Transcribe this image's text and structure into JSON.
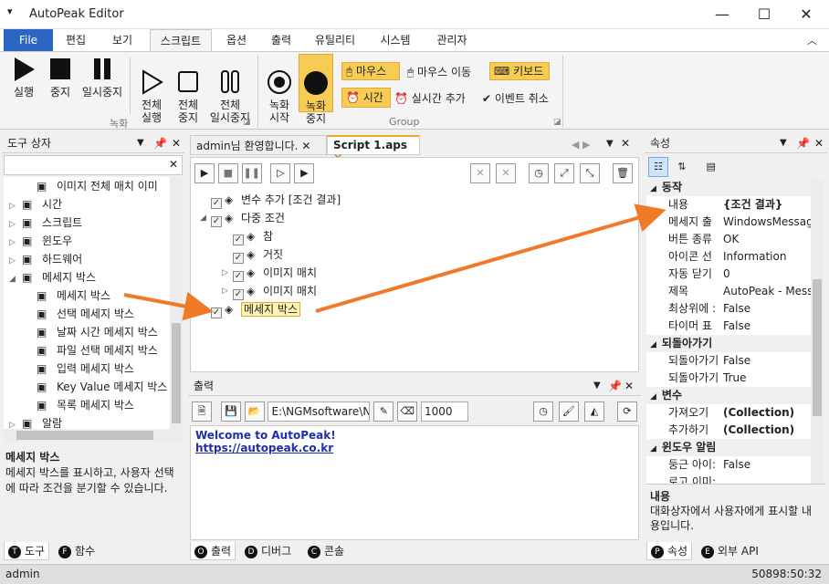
{
  "window": {
    "title": "AutoPeak Editor"
  },
  "ribbon_tabs": [
    "File",
    "편집",
    "보기",
    "스크립트",
    "옵션",
    "출력",
    "유틸리티",
    "시스템",
    "관리자"
  ],
  "ribbon": {
    "rec_group": "녹화",
    "group2": "Group",
    "b_rec": "실행",
    "b_stop": "중지",
    "b_pause": "일시중지",
    "b_all_run": "전체\n실행",
    "b_all_stop": "전체\n중지",
    "b_all_pause": "전체\n일시중지",
    "b_rec_start": "녹화\n시작",
    "b_rec_stop": "녹화\n중지",
    "mouse": "마우스",
    "mouse_move": "마우스 이동",
    "keyboard": "키보드",
    "time": "시간",
    "realtime": "실시간 추가",
    "event_cancel": "이벤트 취소"
  },
  "toolbox": {
    "title": "도구 상자",
    "items": [
      {
        "label": "이미지 전체 매치 이미",
        "indent": 2
      },
      {
        "label": "시간",
        "indent": 1,
        "exp": "▷"
      },
      {
        "label": "스크립트",
        "indent": 1,
        "exp": "▷"
      },
      {
        "label": "윈도우",
        "indent": 1,
        "exp": "▷"
      },
      {
        "label": "하드웨어",
        "indent": 1,
        "exp": "▷"
      },
      {
        "label": "메세지 박스",
        "indent": 1,
        "exp": "◢"
      },
      {
        "label": "메세지 박스",
        "indent": 2
      },
      {
        "label": "선택 메세지 박스",
        "indent": 2
      },
      {
        "label": "날짜 시간 메세지 박스",
        "indent": 2
      },
      {
        "label": "파일 선택 메세지 박스",
        "indent": 2
      },
      {
        "label": "입력 메세지 박스",
        "indent": 2
      },
      {
        "label": "Key Value 메세지 박스",
        "indent": 2
      },
      {
        "label": "목록 메세지 박스",
        "indent": 2
      },
      {
        "label": "알람",
        "indent": 1,
        "exp": "▷"
      }
    ],
    "desc_title": "메세지 박스",
    "desc": "메세지 박스를 표시하고, 사용자 선택에 따라 조건을 분기할 수 있습니다.",
    "tabs": [
      {
        "k": "T",
        "label": "도구"
      },
      {
        "k": "F",
        "label": "함수"
      }
    ]
  },
  "doc": {
    "tab1": "admin님 환영합니다.",
    "tab2": "Script 1.aps",
    "tree": [
      {
        "label": "변수 추가 [조건 결과]",
        "indent": 1
      },
      {
        "label": "다중 조건",
        "indent": 1,
        "exp": "◢"
      },
      {
        "label": "참",
        "indent": 2
      },
      {
        "label": "거짓",
        "indent": 2
      },
      {
        "label": "이미지 매치",
        "indent": 2,
        "exp": "▷"
      },
      {
        "label": "이미지 매치",
        "indent": 2,
        "exp": "▷"
      },
      {
        "label": "메세지 박스",
        "indent": 1,
        "exp": "▷",
        "hl": true
      }
    ]
  },
  "output": {
    "title": "출력",
    "path": "E:\\NGMsoftware\\NG",
    "count": "1000",
    "line1": "Welcome to AutoPeak!",
    "line2": "https://autopeak.co.kr",
    "tabs": [
      {
        "k": "O",
        "label": "출력"
      },
      {
        "k": "D",
        "label": "디버그"
      },
      {
        "k": "C",
        "label": "콘솔"
      }
    ]
  },
  "props": {
    "title": "속성",
    "rows": [
      {
        "cat": "동작"
      },
      {
        "k": "내용",
        "v": "{조건 결과}",
        "b": true
      },
      {
        "k": "메세지 출",
        "v": "WindowsMessage"
      },
      {
        "k": "버튼 종류",
        "v": "OK"
      },
      {
        "k": "아이콘 선",
        "v": "Information"
      },
      {
        "k": "자동 닫기",
        "v": "0"
      },
      {
        "k": "제목",
        "v": "AutoPeak - Messa"
      },
      {
        "k": "최상위에 :",
        "v": "False"
      },
      {
        "k": "타이머 표",
        "v": "False"
      },
      {
        "cat": "되돌아가기"
      },
      {
        "k": "되돌아가기",
        "v": "False"
      },
      {
        "k": "되돌아가기",
        "v": "True"
      },
      {
        "cat": "변수"
      },
      {
        "k": "가져오기",
        "v": "(Collection)",
        "b": true
      },
      {
        "k": "추가하기",
        "v": "(Collection)",
        "b": true
      },
      {
        "cat": "윈도우 알림"
      },
      {
        "k": "둥근 아이:",
        "v": "False"
      },
      {
        "k": "로고 이미:",
        "v": ""
      }
    ],
    "desc_title": "내용",
    "desc": "대화상자에서 사용자에게 표시할 내용입니다.",
    "tabs": [
      {
        "k": "P",
        "label": "속성"
      },
      {
        "k": "E",
        "label": "외부 API"
      }
    ]
  },
  "status": {
    "user": "admin",
    "time": "50898:50:32"
  }
}
